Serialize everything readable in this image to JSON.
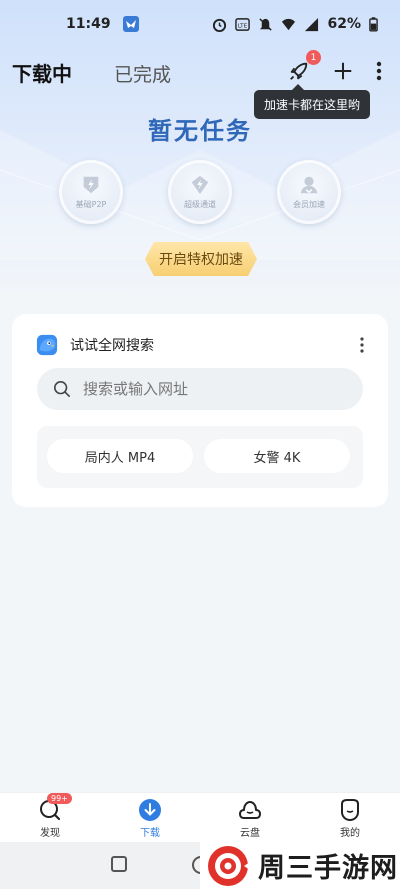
{
  "status_bar": {
    "time": "11:49",
    "battery": "62%",
    "icons": [
      "alarm-icon",
      "volte-icon",
      "mute-icon",
      "wifi-icon",
      "signal-4g-icon",
      "battery-icon"
    ]
  },
  "header": {
    "tabs": [
      "下载中",
      "已完成"
    ],
    "boost_badge": "1",
    "tooltip": "加速卡都在这里哟"
  },
  "empty_state": {
    "title": "暂无任务",
    "perks": [
      "基础P2P",
      "超级通道",
      "会员加速"
    ],
    "boost_button": "开启特权加速"
  },
  "search_card": {
    "title": "试试全网搜索",
    "placeholder": "搜索或输入网址",
    "suggestions": [
      "局内人 MP4",
      "女警 4K"
    ]
  },
  "bottom_nav": {
    "items": [
      {
        "label": "发现",
        "badge": "99+",
        "icon": "discover-icon"
      },
      {
        "label": "下载",
        "icon": "download-icon",
        "active": true
      },
      {
        "label": "云盘",
        "icon": "cloud-icon"
      },
      {
        "label": "我的",
        "icon": "profile-icon"
      }
    ]
  },
  "watermark": {
    "text": "周三手游网"
  },
  "colors": {
    "accent": "#2f7de1",
    "title_blue": "#2f68b8",
    "badge_red": "#f05a5a",
    "boost_gold": "#f7cf73"
  }
}
